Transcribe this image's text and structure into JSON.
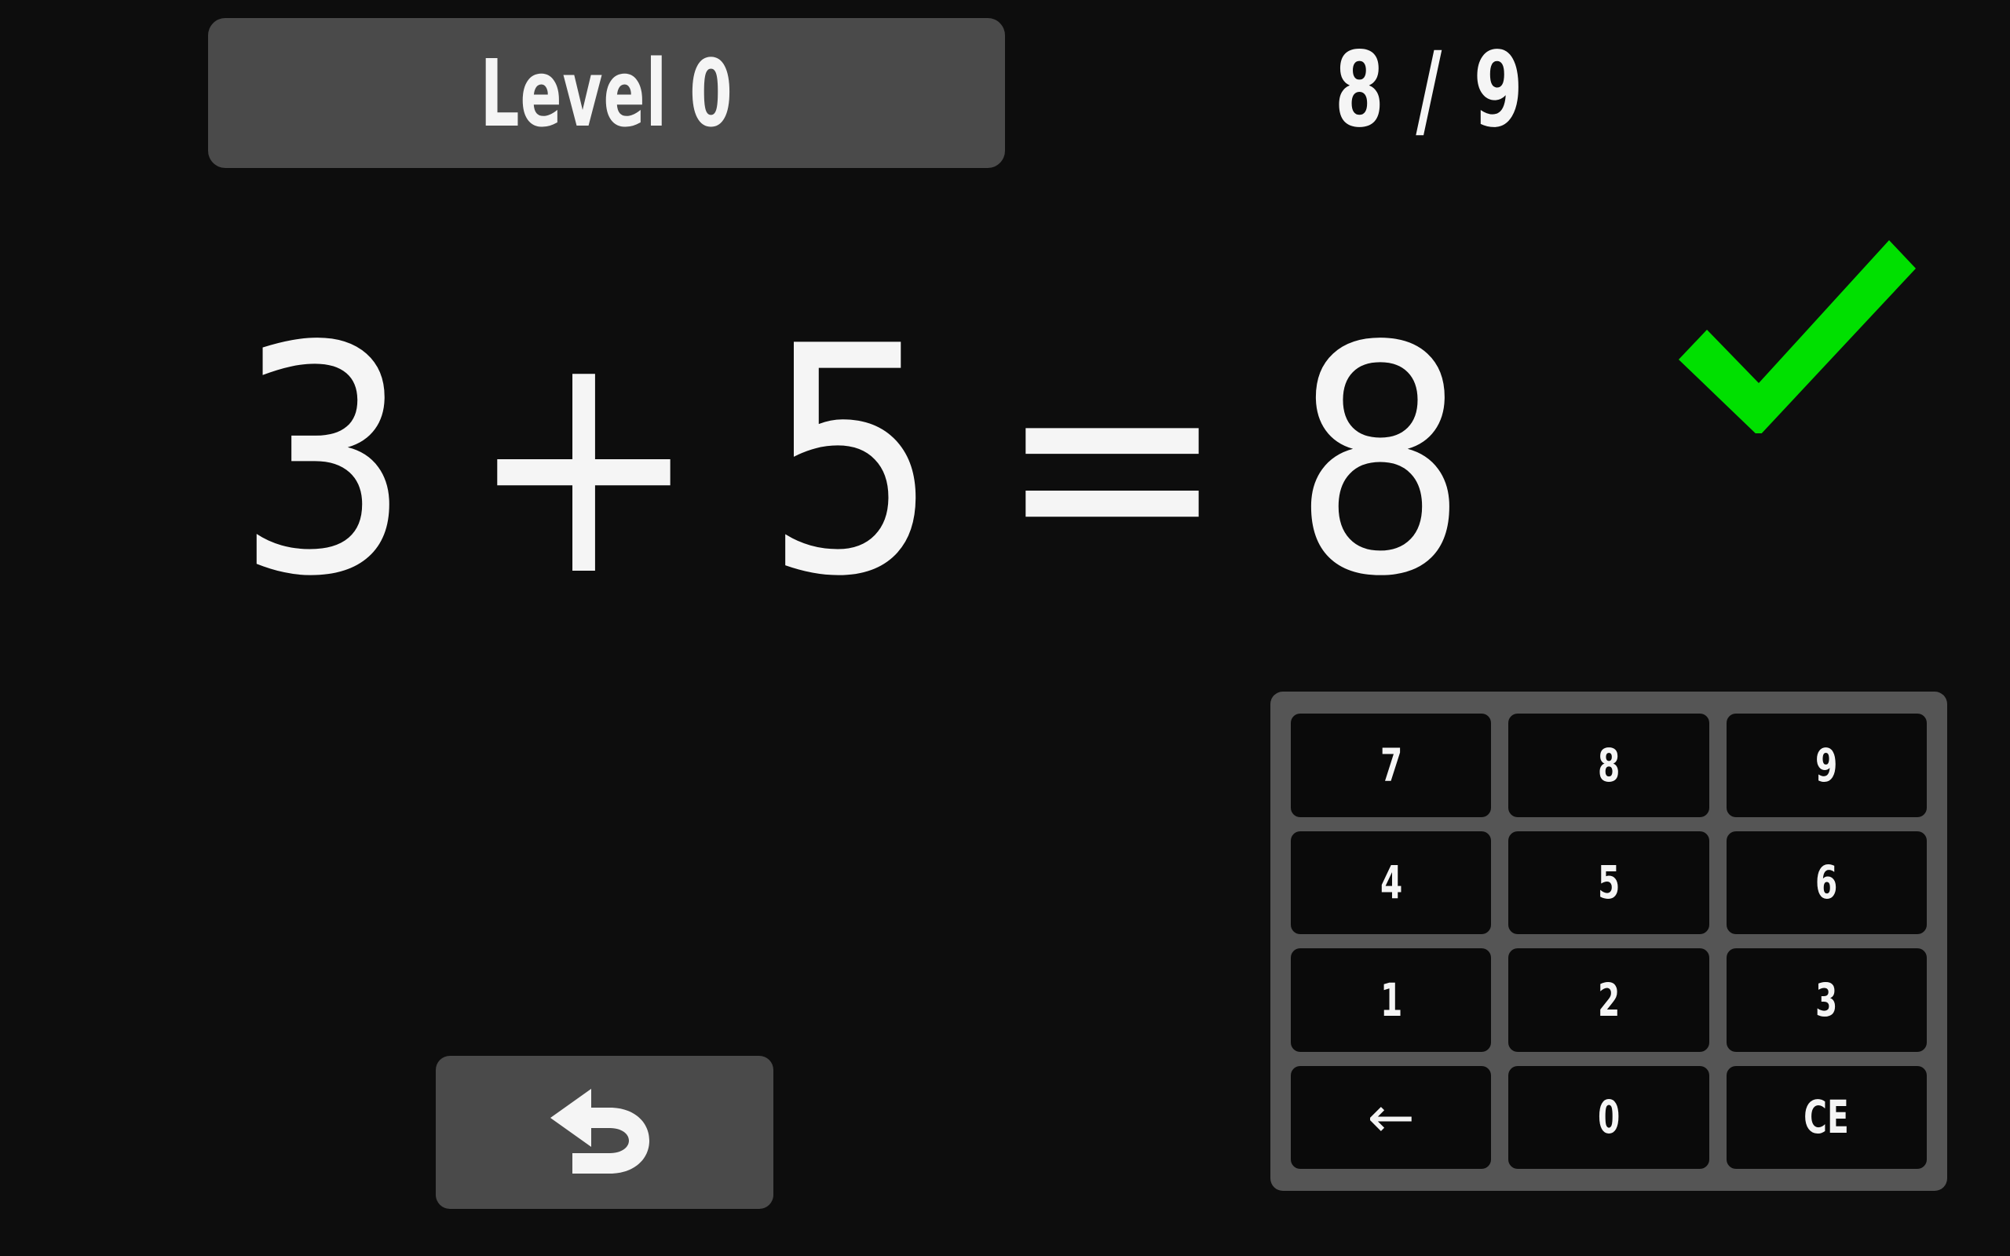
{
  "screen": {
    "name": "math-practice-game",
    "background_color": "#0d0d0d"
  },
  "header": {
    "level_badge": {
      "label": "Level 0",
      "background_color": "#4a4a4a",
      "text_color": "#f5f5f5"
    },
    "progress": {
      "text": "8 / 9",
      "current": "8",
      "total": "9",
      "separator": "/"
    }
  },
  "equation": {
    "full_text": "3 + 5 = 8",
    "left_operand": "3",
    "operator": "+",
    "right_operand": "5",
    "equals": "=",
    "answer": "8",
    "text_color": "#f5f5f5"
  },
  "feedback": {
    "icon": "check-icon",
    "state": "correct",
    "color": "#00e000"
  },
  "keypad": {
    "panel_color": "#555555",
    "key_color": "#0a0a0a",
    "key_text_color": "#f5f5f5",
    "keys": [
      {
        "label": "7",
        "name": "key-7"
      },
      {
        "label": "8",
        "name": "key-8"
      },
      {
        "label": "9",
        "name": "key-9"
      },
      {
        "label": "4",
        "name": "key-4"
      },
      {
        "label": "5",
        "name": "key-5"
      },
      {
        "label": "6",
        "name": "key-6"
      },
      {
        "label": "1",
        "name": "key-1"
      },
      {
        "label": "2",
        "name": "key-2"
      },
      {
        "label": "3",
        "name": "key-3"
      },
      {
        "label": "←",
        "name": "key-backspace"
      },
      {
        "label": "0",
        "name": "key-0"
      },
      {
        "label": "CE",
        "name": "key-clear-entry"
      }
    ]
  },
  "undo": {
    "icon": "undo-arrow-icon",
    "background_color": "#4a4a4a",
    "icon_color": "#f5f5f5"
  }
}
